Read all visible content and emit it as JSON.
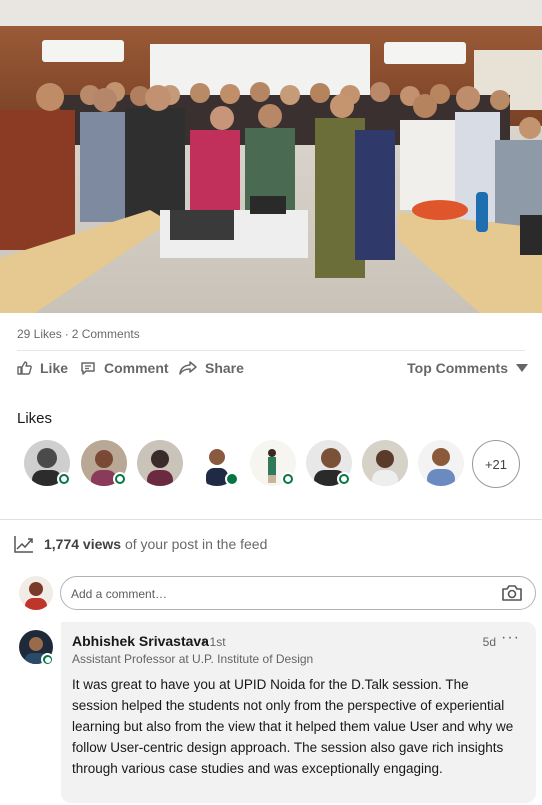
{
  "post": {
    "photo_icon": "group-photo"
  },
  "social": {
    "likes": "29 Likes",
    "separator": "·",
    "comments": "2 Comments"
  },
  "actions": {
    "like": "Like",
    "comment": "Comment",
    "share": "Share",
    "sort": "Top Comments"
  },
  "likes_section": {
    "title": "Likes",
    "more": "+21"
  },
  "views": {
    "count": "1,774 views",
    "suffix": " of your post in the feed"
  },
  "comment_box": {
    "placeholder": "Add a comment…"
  },
  "comment": {
    "author": "Abhishek Srivastava",
    "degree": "• 1st",
    "headline": "Assistant Professor at U.P. Institute of Design",
    "time": "5d",
    "menu": "···",
    "text": "It was great to have you at UPID Noida for the D.Talk session. The session helped the students not only from the perspective of experiential learning but also from the view that it helped them value User and why we follow User-centric design approach. The session also gave rich insights through various case studies and was exceptionally engaging."
  },
  "colors": {
    "online": "#057642",
    "bubble": "#f2f2f2",
    "muted_text": "#666666"
  }
}
